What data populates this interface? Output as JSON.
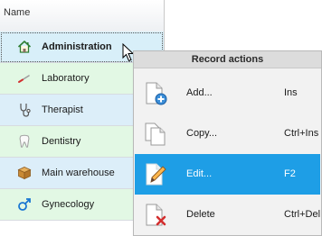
{
  "grid": {
    "header": "Name",
    "rows": [
      {
        "label": "Administration",
        "icon": "home-icon"
      },
      {
        "label": "Laboratory",
        "icon": "thermometer-icon"
      },
      {
        "label": "Therapist",
        "icon": "stethoscope-icon"
      },
      {
        "label": "Dentistry",
        "icon": "tooth-icon"
      },
      {
        "label": "Main warehouse",
        "icon": "box-icon"
      },
      {
        "label": "Gynecology",
        "icon": "male-symbol-icon"
      }
    ]
  },
  "context_menu": {
    "title": "Record actions",
    "items": [
      {
        "label": "Add...",
        "shortcut": "Ins",
        "icon": "add-document-icon"
      },
      {
        "label": "Copy...",
        "shortcut": "Ctrl+Ins",
        "icon": "copy-document-icon"
      },
      {
        "label": "Edit...",
        "shortcut": "F2",
        "icon": "edit-document-icon"
      },
      {
        "label": "Delete",
        "shortcut": "Ctrl+Del",
        "icon": "delete-document-icon"
      }
    ]
  },
  "colors": {
    "accent": "#1e9ee6",
    "row_green": "#e2f8e4",
    "row_blue": "#dceef9"
  }
}
